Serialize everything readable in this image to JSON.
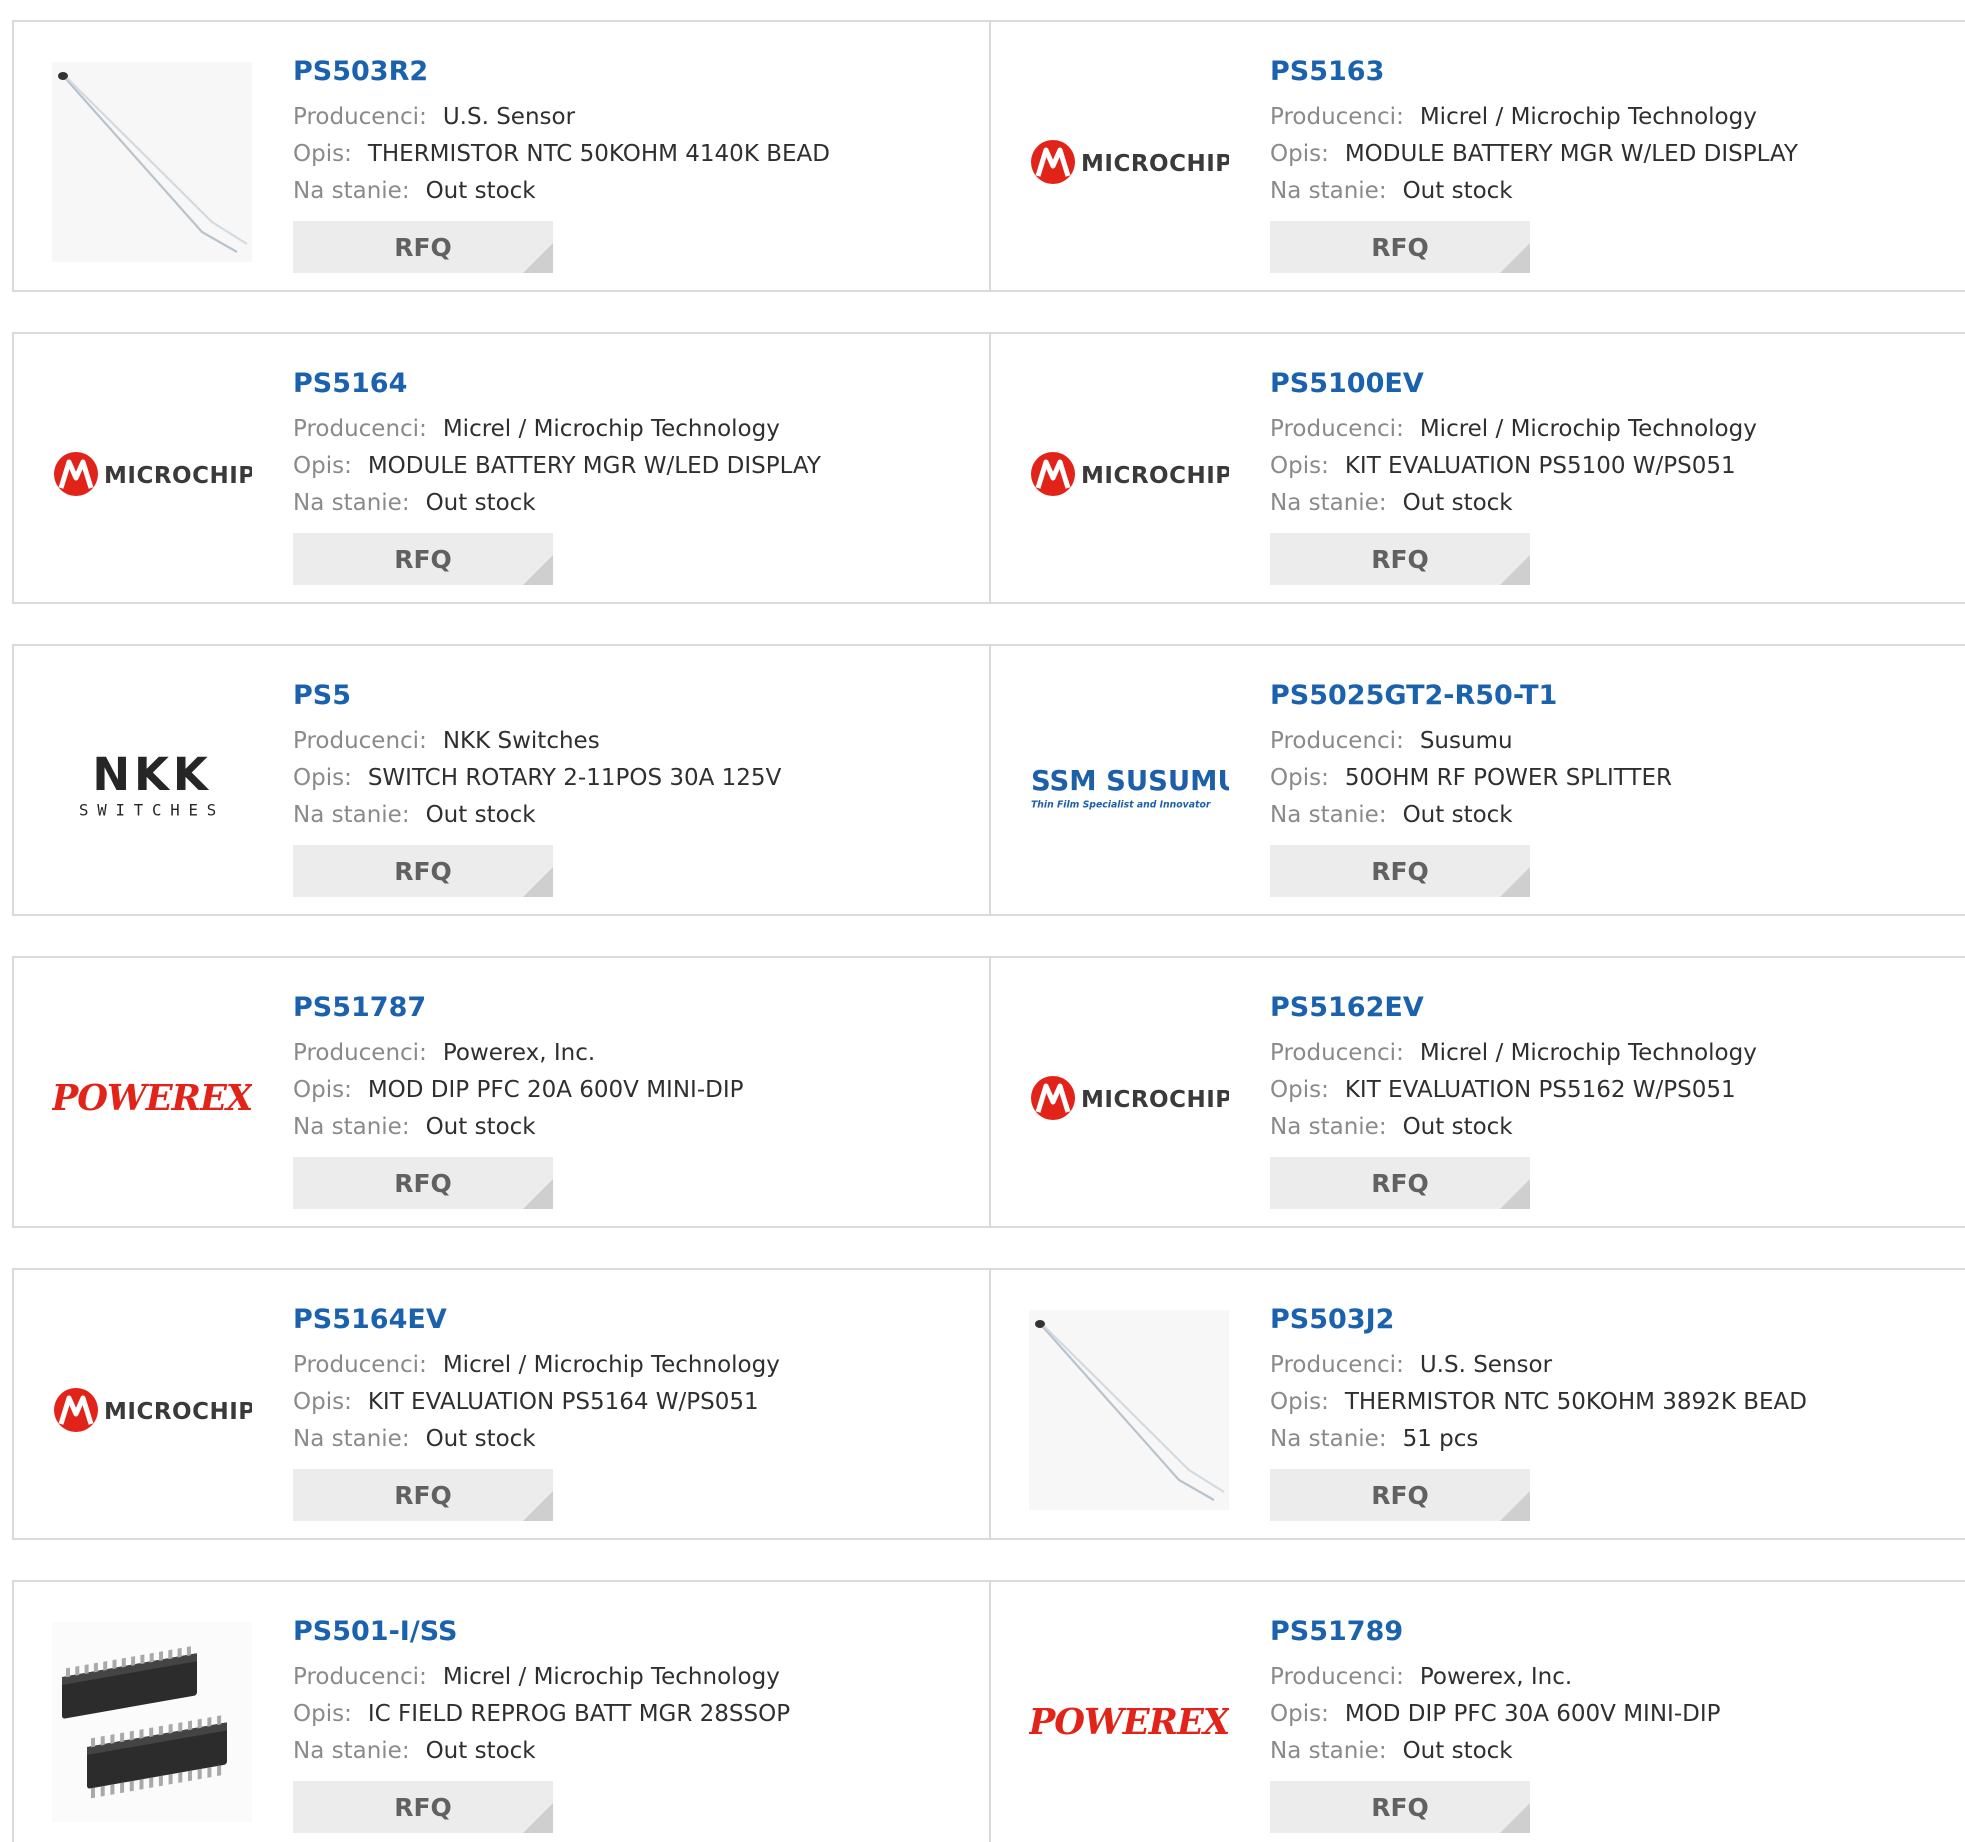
{
  "labels": {
    "manufacturer": "Producenci:",
    "description": "Opis:",
    "stock": "Na stanie:",
    "rfq": "RFQ"
  },
  "brand_marks": {
    "microchip": "MICROCHIP",
    "nkk_top": "NKK",
    "nkk_bottom": "SWITCHES",
    "susumu_top": "SSM SUSUMU",
    "susumu_tag": "Thin Film Specialist and Innovator",
    "powerex": "POWEREX"
  },
  "rows": [
    [
      {
        "part": "PS503R2",
        "manufacturer": "U.S. Sensor",
        "description": "THERMISTOR NTC 50KOHM 4140K BEAD",
        "stock": "Out stock",
        "image": "thermistor"
      },
      {
        "part": "PS5163",
        "manufacturer": "Micrel / Microchip Technology",
        "description": "MODULE BATTERY MGR W/LED DISPLAY",
        "stock": "Out stock",
        "image": "microchip-logo"
      }
    ],
    [
      {
        "part": "PS5164",
        "manufacturer": "Micrel / Microchip Technology",
        "description": "MODULE BATTERY MGR W/LED DISPLAY",
        "stock": "Out stock",
        "image": "microchip-logo"
      },
      {
        "part": "PS5100EV",
        "manufacturer": "Micrel / Microchip Technology",
        "description": "KIT EVALUATION PS5100 W/PS051",
        "stock": "Out stock",
        "image": "microchip-logo"
      }
    ],
    [
      {
        "part": "PS5",
        "manufacturer": "NKK Switches",
        "description": "SWITCH ROTARY 2-11POS 30A 125V",
        "stock": "Out stock",
        "image": "nkk-logo"
      },
      {
        "part": "PS5025GT2-R50-T1",
        "manufacturer": "Susumu",
        "description": "50OHM RF POWER SPLITTER",
        "stock": "Out stock",
        "image": "susumu-logo"
      }
    ],
    [
      {
        "part": "PS51787",
        "manufacturer": "Powerex, Inc.",
        "description": "MOD DIP PFC 20A 600V MINI-DIP",
        "stock": "Out stock",
        "image": "powerex-logo"
      },
      {
        "part": "PS5162EV",
        "manufacturer": "Micrel / Microchip Technology",
        "description": "KIT EVALUATION PS5162 W/PS051",
        "stock": "Out stock",
        "image": "microchip-logo"
      }
    ],
    [
      {
        "part": "PS5164EV",
        "manufacturer": "Micrel / Microchip Technology",
        "description": "KIT EVALUATION PS5164 W/PS051",
        "stock": "Out stock",
        "image": "microchip-logo"
      },
      {
        "part": "PS503J2",
        "manufacturer": "U.S. Sensor",
        "description": "THERMISTOR NTC 50KOHM 3892K BEAD",
        "stock": "51 pcs",
        "image": "thermistor"
      }
    ],
    [
      {
        "part": "PS501-I/SS",
        "manufacturer": "Micrel / Microchip Technology",
        "description": "IC FIELD REPROG BATT MGR 28SSOP",
        "stock": "Out stock",
        "image": "ssop-chip"
      },
      {
        "part": "PS51789",
        "manufacturer": "Powerex, Inc.",
        "description": "MOD DIP PFC 30A 600V MINI-DIP",
        "stock": "Out stock",
        "image": "powerex-logo"
      }
    ]
  ]
}
